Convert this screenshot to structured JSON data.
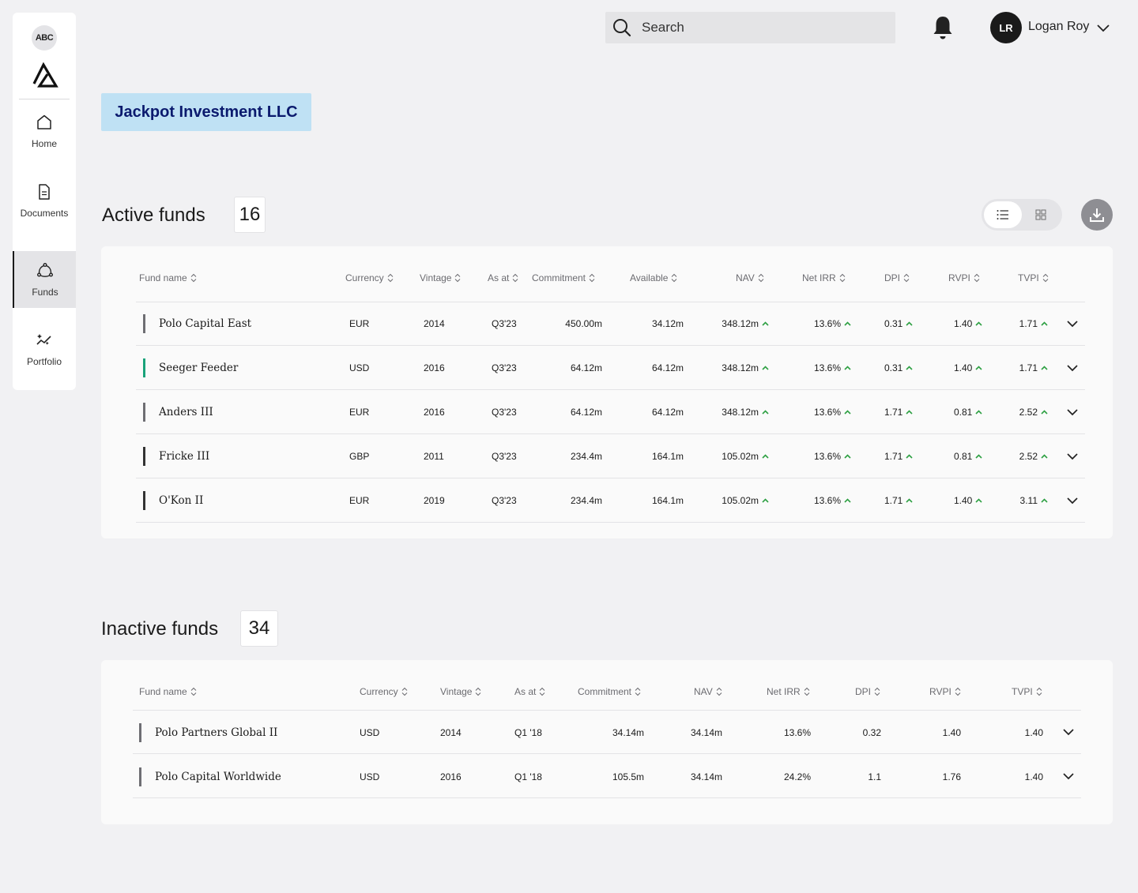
{
  "sidebar": {
    "logo_badge": "ABC",
    "items": [
      {
        "label": "Home",
        "icon": "home-icon"
      },
      {
        "label": "Documents",
        "icon": "document-icon"
      },
      {
        "label": "Funds",
        "icon": "funds-icon",
        "active": true
      },
      {
        "label": "Portfolio",
        "icon": "portfolio-icon"
      }
    ]
  },
  "header": {
    "search_placeholder": "Search",
    "user_initials": "LR",
    "user_name": "Logan Roy"
  },
  "entity_name": "Jackpot Investment LLC",
  "colors": {
    "entity_bg": "#bfe1f4",
    "entity_text": "#0b1a6e",
    "trend_up": "#2ea043",
    "bar_grey": "#6e6e73",
    "bar_green": "#1aa37a",
    "bar_dark": "#333333"
  },
  "active": {
    "title": "Active funds",
    "count": "16",
    "columns": [
      "Fund name",
      "Currency",
      "Vintage",
      "As at",
      "Commitment",
      "Available",
      "NAV",
      "Net IRR",
      "DPI",
      "RVPI",
      "TVPI"
    ],
    "rows": [
      {
        "name": "Polo Capital East",
        "bar": "grey",
        "currency": "EUR",
        "vintage": "2014",
        "as_at": "Q3'23",
        "commitment": "450.00m",
        "available": "34.12m",
        "nav": "348.12m",
        "irr": "13.6%",
        "dpi": "0.31",
        "rvpi": "1.40",
        "tvpi": "1.71"
      },
      {
        "name": "Seeger Feeder",
        "bar": "green",
        "currency": "USD",
        "vintage": "2016",
        "as_at": "Q3'23",
        "commitment": "64.12m",
        "available": "64.12m",
        "nav": "348.12m",
        "irr": "13.6%",
        "dpi": "0.31",
        "rvpi": "1.40",
        "tvpi": "1.71"
      },
      {
        "name": "Anders III",
        "bar": "grey",
        "currency": "EUR",
        "vintage": "2016",
        "as_at": "Q3'23",
        "commitment": "64.12m",
        "available": "64.12m",
        "nav": "348.12m",
        "irr": "13.6%",
        "dpi": "1.71",
        "rvpi": "0.81",
        "tvpi": "2.52"
      },
      {
        "name": "Fricke III",
        "bar": "dark",
        "currency": "GBP",
        "vintage": "2011",
        "as_at": "Q3'23",
        "commitment": "234.4m",
        "available": "164.1m",
        "nav": "105.02m",
        "irr": "13.6%",
        "dpi": "1.71",
        "rvpi": "0.81",
        "tvpi": "2.52"
      },
      {
        "name": "O'Kon II",
        "bar": "dark",
        "currency": "EUR",
        "vintage": "2019",
        "as_at": "Q3'23",
        "commitment": "234.4m",
        "available": "164.1m",
        "nav": "105.02m",
        "irr": "13.6%",
        "dpi": "1.71",
        "rvpi": "1.40",
        "tvpi": "3.11"
      }
    ]
  },
  "inactive": {
    "title": "Inactive funds",
    "count": "34",
    "columns": [
      "Fund name",
      "Currency",
      "Vintage",
      "As at",
      "Commitment",
      "NAV",
      "Net IRR",
      "DPI",
      "RVPI",
      "TVPI"
    ],
    "rows": [
      {
        "name": "Polo Partners Global II",
        "currency": "USD",
        "vintage": "2014",
        "as_at": "Q1 '18",
        "commitment": "34.14m",
        "nav": "34.14m",
        "irr": "13.6%",
        "dpi": "0.32",
        "rvpi": "1.40",
        "tvpi": "1.40"
      },
      {
        "name": "Polo Capital Worldwide",
        "currency": "USD",
        "vintage": "2016",
        "as_at": "Q1 '18",
        "commitment": "105.5m",
        "nav": "34.14m",
        "irr": "24.2%",
        "dpi": "1.1",
        "rvpi": "1.76",
        "tvpi": "1.40"
      }
    ]
  }
}
